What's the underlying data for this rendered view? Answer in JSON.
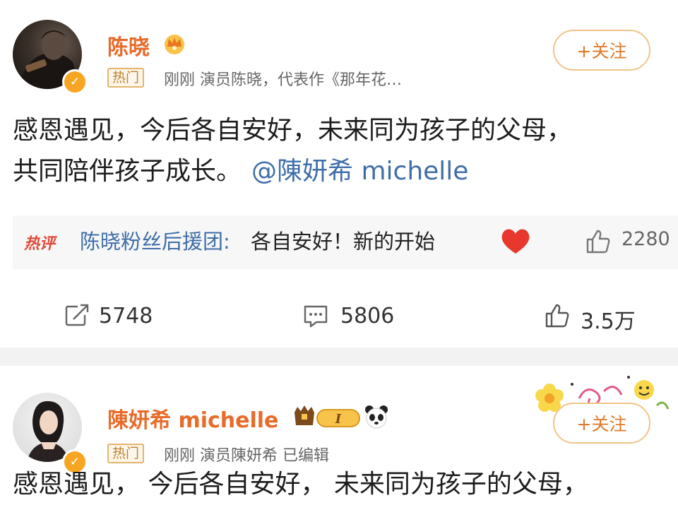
{
  "post1": {
    "author": "陈晓",
    "tag": "热门",
    "meta": "刚刚  演员陈晓，代表作《那年花…",
    "follow_label": "+关注",
    "text_line1": "感恩遇见，今后各自安好，未来同为孩子的父母，",
    "text_line2": "共同陪伴孩子成长。",
    "mention": "@陳妍希 michelle",
    "hot_comment": {
      "badge": "热评",
      "user": "陈晓粉丝后援团:",
      "text": "各自安好！新的开始",
      "likes": "2280"
    },
    "actions": {
      "reposts": "5748",
      "comments": "5806",
      "likes": "3.5万"
    }
  },
  "post2": {
    "author": "陳妍希 michelle",
    "level": "I",
    "tag": "热门",
    "meta": "刚刚  演员陳妍希  已编辑",
    "follow_label": "+关注",
    "text_line1": "感恩遇见，  今后各自安好，  未来同为孩子的父母，"
  },
  "colors": {
    "name_orange": "#e86b2a",
    "link_blue": "#3f6ea8",
    "follow_border": "#f0c488",
    "badge_gold": "#f6a623",
    "heart_red": "#e8372c"
  }
}
